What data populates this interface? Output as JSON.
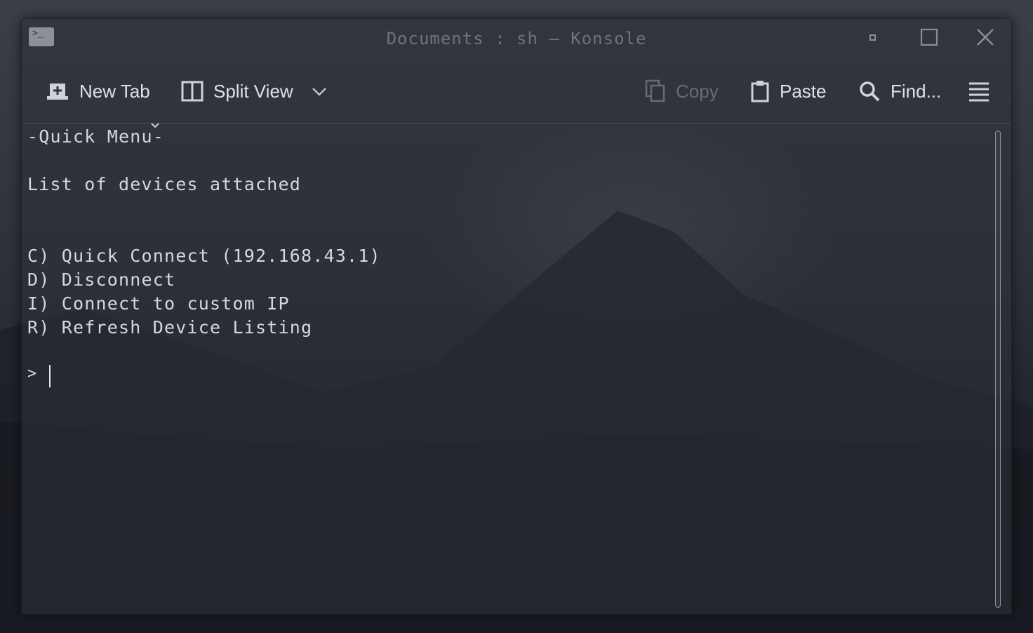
{
  "window": {
    "title": "Documents : sh — Konsole",
    "app_icon": "terminal-icon",
    "controls": [
      "minimize-icon",
      "maximize-icon",
      "close-icon"
    ]
  },
  "toolbar": {
    "new_tab_label": "New Tab",
    "split_view_label": "Split View",
    "copy_label": "Copy",
    "copy_enabled": false,
    "paste_label": "Paste",
    "find_label": "Find...",
    "icons": {
      "new_tab": "new-tab-icon",
      "split_view": "split-view-icon",
      "split_dropdown": "chevron-down-icon",
      "copy": "copy-icon",
      "paste": "paste-icon",
      "find": "search-icon",
      "menu": "hamburger-menu-icon"
    }
  },
  "terminal": {
    "lines": [
      "-Quick Menu-",
      "List of devices attached",
      "C) Quick Connect (192.168.43.1)",
      "D) Disconnect",
      "I) Connect to custom IP",
      "R) Refresh Device Listing",
      "> "
    ]
  },
  "colors": {
    "background": "#2c3039",
    "text": "#d6d8db",
    "disabled_text": "#676b73"
  }
}
